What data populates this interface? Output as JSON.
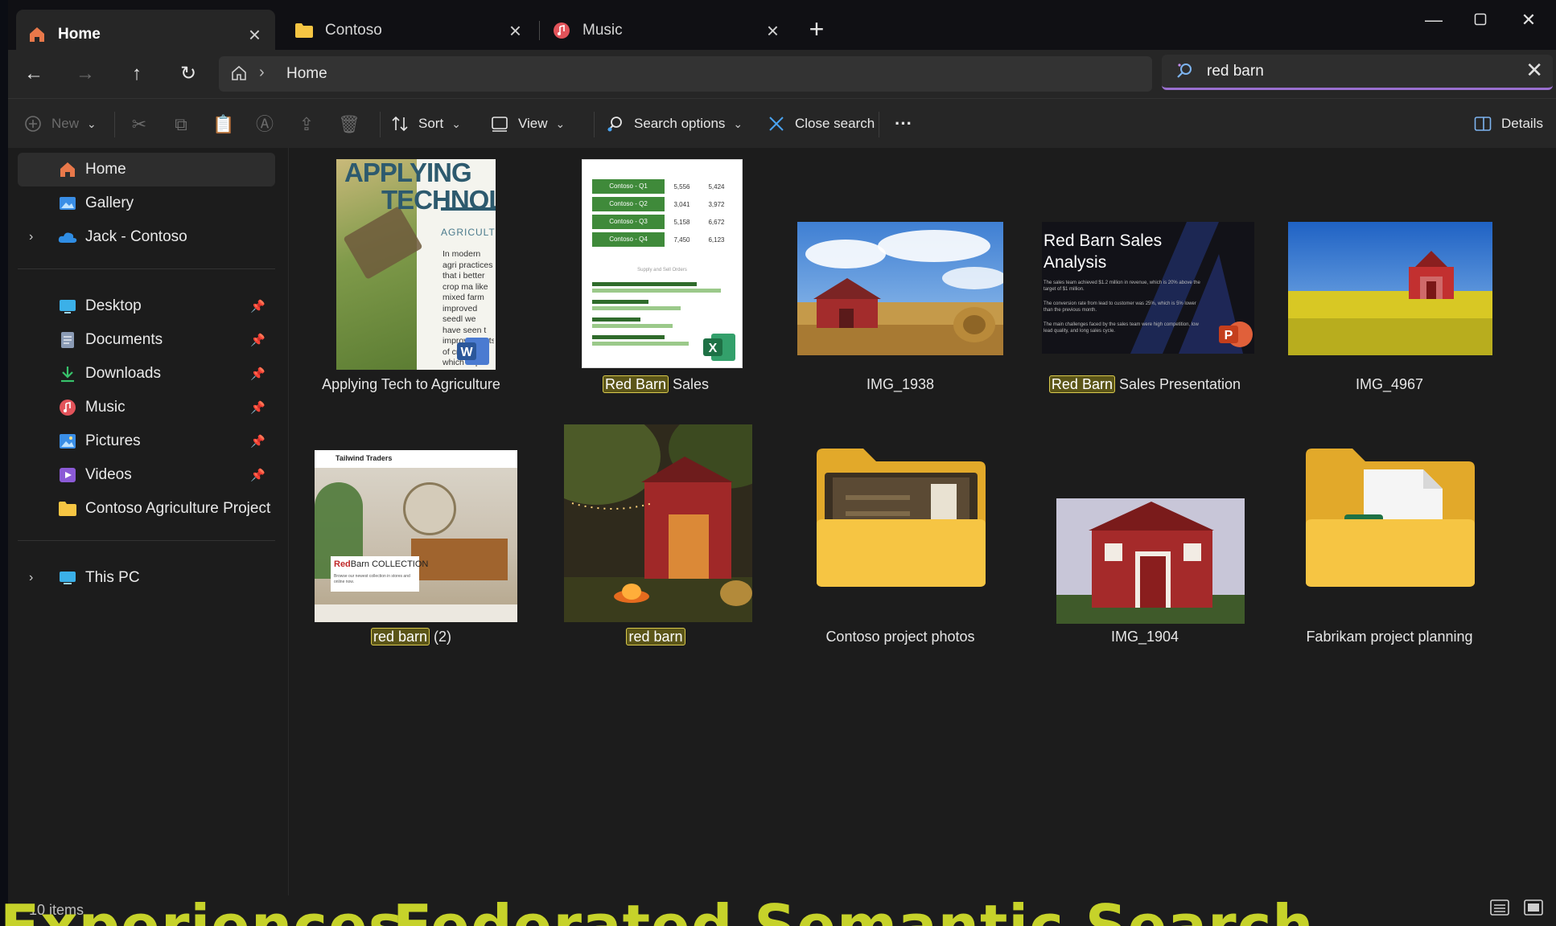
{
  "tabs": [
    {
      "label": "Home",
      "icon": "home-icon",
      "active": true
    },
    {
      "label": "Contoso",
      "icon": "folder-icon",
      "active": false
    },
    {
      "label": "Music",
      "icon": "music-icon",
      "active": false
    }
  ],
  "address": {
    "crumb": "Home"
  },
  "search": {
    "query": "red barn"
  },
  "commands": {
    "new": "New",
    "sort": "Sort",
    "view": "View",
    "search_options": "Search options",
    "close_search": "Close search",
    "more": "···",
    "details": "Details"
  },
  "sidebar": {
    "items": [
      {
        "label": "Home",
        "icon": "home-icon"
      },
      {
        "label": "Gallery",
        "icon": "gallery-icon"
      },
      {
        "label": "Jack - Contoso",
        "icon": "onedrive-icon"
      },
      {
        "label": "Desktop",
        "icon": "desktop-icon"
      },
      {
        "label": "Documents",
        "icon": "documents-icon"
      },
      {
        "label": "Downloads",
        "icon": "downloads-icon"
      },
      {
        "label": "Music",
        "icon": "music-icon"
      },
      {
        "label": "Pictures",
        "icon": "pictures-icon"
      },
      {
        "label": "Videos",
        "icon": "videos-icon"
      },
      {
        "label": "Contoso Agriculture Project",
        "icon": "folder-icon"
      },
      {
        "label": "This PC",
        "icon": "pc-icon"
      }
    ]
  },
  "items": [
    {
      "name": "Applying Tech to Agriculture",
      "highlight": "",
      "rest": "",
      "type": "word-doc",
      "doc_title_1": "APPLYING",
      "doc_title_2": "TECHNOL",
      "doc_sub": "AGRICULT",
      "doc_body": "In modern agri practices that i better crop ma like mixed farm improved seedl we have seen t improvements of crops which impr live our goals is to"
    },
    {
      "name": "",
      "highlight": "Red Barn",
      "rest": " Sales",
      "type": "excel",
      "rows": [
        [
          "Contoso - Q1",
          "5,556",
          "5,424"
        ],
        [
          "Contoso - Q2",
          "3,041",
          "3,972"
        ],
        [
          "Contoso - Q3",
          "5,158",
          "6,672"
        ],
        [
          "Contoso - Q4",
          "7,450",
          "6,123"
        ]
      ],
      "chart_caption": "Supply and Sell Orders"
    },
    {
      "name": "IMG_1938",
      "highlight": "",
      "rest": "",
      "type": "photo"
    },
    {
      "name": "",
      "highlight": "Red Barn",
      "rest": " Sales Presentation",
      "type": "powerpoint",
      "slide_title": "Red Barn Sales Analysis",
      "slide_text_1": "The sales team achieved $1.2 million in revenue, which is 20% above the target of $1 million.",
      "slide_text_2": "The conversion rate from lead to customer was 25%, which is 5% lower than the previous month.",
      "slide_text_3": "The main challenges faced by the sales team were high competition, low lead quality, and long sales cycle."
    },
    {
      "name": "IMG_4967",
      "highlight": "",
      "rest": "",
      "type": "photo"
    },
    {
      "name": "",
      "highlight": "red barn",
      "rest": " (2)",
      "type": "web",
      "site": "Tailwind Traders",
      "promo_red": "Red",
      "promo_rest": "Barn COLLECTION",
      "promo_sub": "Browse our newest collection in stores and online now."
    },
    {
      "name": "",
      "highlight": "red barn",
      "rest": "",
      "type": "photo"
    },
    {
      "name": "Contoso project photos",
      "highlight": "",
      "rest": "",
      "type": "folder"
    },
    {
      "name": "IMG_1904",
      "highlight": "",
      "rest": "",
      "type": "photo"
    },
    {
      "name": "Fabrikam project planning",
      "highlight": "",
      "rest": "",
      "type": "folder"
    }
  ],
  "status": {
    "count": "10 items"
  },
  "overlay_caption": {
    "left": "Experiences",
    "right": "Federated Semantic Search"
  },
  "colors": {
    "accent": "#9a6fd0",
    "highlight_border": "#d9c94d",
    "folder": "#f6c543",
    "excel": "#1e7145",
    "word": "#2b579a",
    "powerpoint": "#c43e1c",
    "barn_red": "#b02a2a"
  }
}
